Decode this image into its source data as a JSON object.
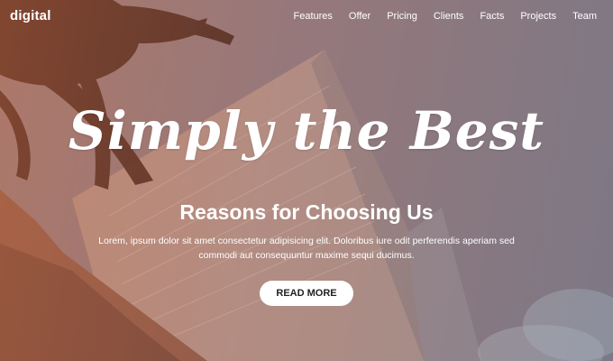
{
  "brand": "digital",
  "nav": [
    "Features",
    "Offer",
    "Pricing",
    "Clients",
    "Facts",
    "Projects",
    "Team"
  ],
  "hero": {
    "title": "Simply the Best",
    "subtitle": "Reasons for Choosing Us",
    "description": "Lorem, ipsum dolor sit amet consectetur adipisicing elit. Doloribus iure odit perferendis aperiam sed commodi aut consequuntur maxime sequi ducimus.",
    "button": "READ MORE"
  },
  "colors": {
    "gradient_left": "#c8795a",
    "gradient_right": "#5b6c7c",
    "button_bg": "#ffffff"
  }
}
